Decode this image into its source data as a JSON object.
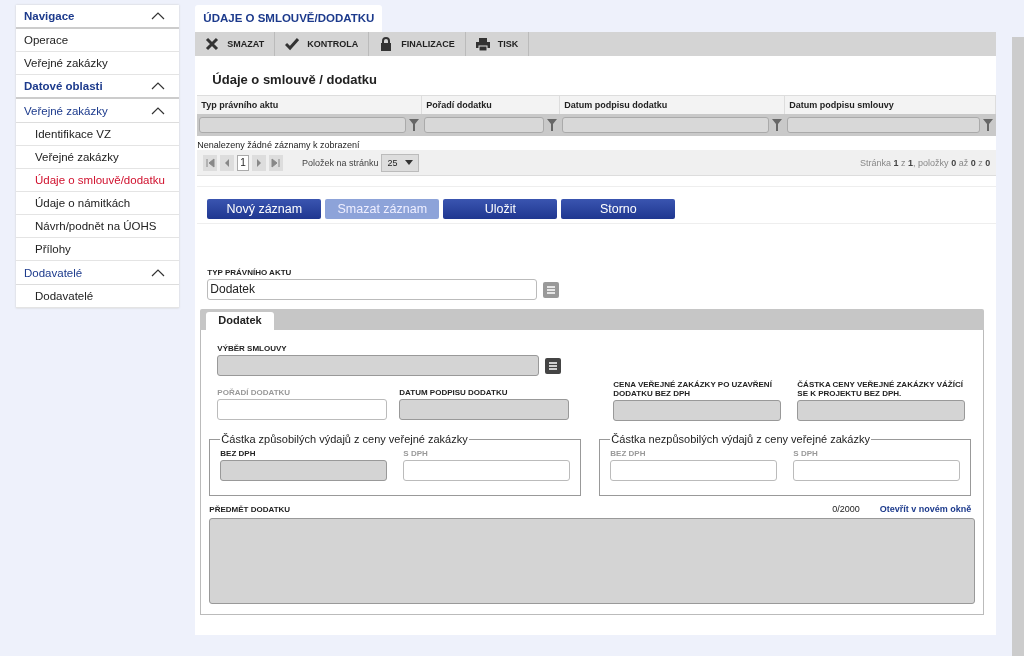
{
  "sidebar": {
    "sections": [
      {
        "title": "Navigace",
        "kind": "group",
        "expanded": true,
        "items": [
          {
            "label": "Operace",
            "selected": false
          },
          {
            "label": "Veřejné zakázky",
            "selected": false
          }
        ]
      },
      {
        "title": "Datové oblasti",
        "kind": "group",
        "expanded": true
      },
      {
        "title": "Veřejné zakázky",
        "kind": "subgroup",
        "expanded": true,
        "items": [
          {
            "label": "Identifikace VZ",
            "selected": false
          },
          {
            "label": "Veřejné zakázky",
            "selected": false
          },
          {
            "label": "Údaje o smlouvě/dodatku",
            "selected": true
          },
          {
            "label": "Údaje o námitkách",
            "selected": false
          },
          {
            "label": "Návrh/podnět na ÚOHS",
            "selected": false
          },
          {
            "label": "Přílohy",
            "selected": false
          }
        ]
      },
      {
        "title": "Dodavatelé",
        "kind": "subgroup",
        "expanded": true,
        "items": [
          {
            "label": "Dodavatelé",
            "selected": false
          }
        ]
      }
    ]
  },
  "page_tab": {
    "label": "ÚDAJE O SMLOUVĚ/DODATKU",
    "selected": true
  },
  "toolbar": [
    {
      "kind": "delete",
      "label": "SMAZAT"
    },
    {
      "kind": "check",
      "label": "KONTROLA"
    },
    {
      "kind": "lock",
      "label": "FINALIZACE"
    },
    {
      "kind": "print",
      "label": "TISK"
    }
  ],
  "section_title": "Údaje o smlouvě / dodatku",
  "table": {
    "columns": [
      "Typ právního aktu",
      "Pořadí dodatku",
      "Datum podpisu dodatku",
      "Datum podpisu smlouvy"
    ],
    "empty_message": "Nenalezeny žádné záznamy k zobrazení"
  },
  "pager": {
    "page": "1",
    "per_page_label": "Položek na stránku",
    "per_page": "25",
    "summary": "Stránka **1** z **1**, položky **0** až **0** z **0**"
  },
  "buttons": [
    {
      "label": "Nový záznam",
      "disabled": false
    },
    {
      "label": "Smazat záznam",
      "disabled": true
    },
    {
      "label": "Uložit",
      "disabled": false
    },
    {
      "label": "Storno",
      "disabled": false
    }
  ],
  "type_field": {
    "label": "TYP PRÁVNÍHO AKTU",
    "value": "Dodatek"
  },
  "form_tab": {
    "label": "Dodatek",
    "selected": true
  },
  "form": {
    "contract": {
      "label": "VÝBĚR SMLOUVY",
      "disabled": true
    },
    "order": {
      "label": "POŘADÍ DODATKU",
      "disabled": false
    },
    "date": {
      "label": "DATUM PODPISU DODATKU",
      "disabled": true
    },
    "price": {
      "label": "CENA VEŘEJNÉ ZAKÁZKY PO UZAVŘENÍ DODATKU BEZ DPH",
      "disabled": true
    },
    "project_amount": {
      "label": "ČÁSTKA CENY VEŘEJNÉ ZAKÁZKY VÁŽÍCÍ SE K PROJEKTU BEZ DPH.",
      "disabled": true
    },
    "groups": [
      {
        "legend": "Částka způsobilých výdajů z ceny veřejné zakázky",
        "fields": [
          {
            "label": "BEZ DPH",
            "disabled": true
          },
          {
            "label": "S DPH",
            "disabled": false
          }
        ]
      },
      {
        "legend": "Částka nezpůsobilých výdajů z ceny veřejné zakázky",
        "fields": [
          {
            "label": "BEZ DPH",
            "disabled": false
          },
          {
            "label": "S DPH",
            "disabled": false
          }
        ]
      }
    ],
    "subject": {
      "label": "PŘEDMĚT DODATKU",
      "counter": "0/2000",
      "link": "Otevřít v novém okně",
      "disabled": true
    }
  }
}
